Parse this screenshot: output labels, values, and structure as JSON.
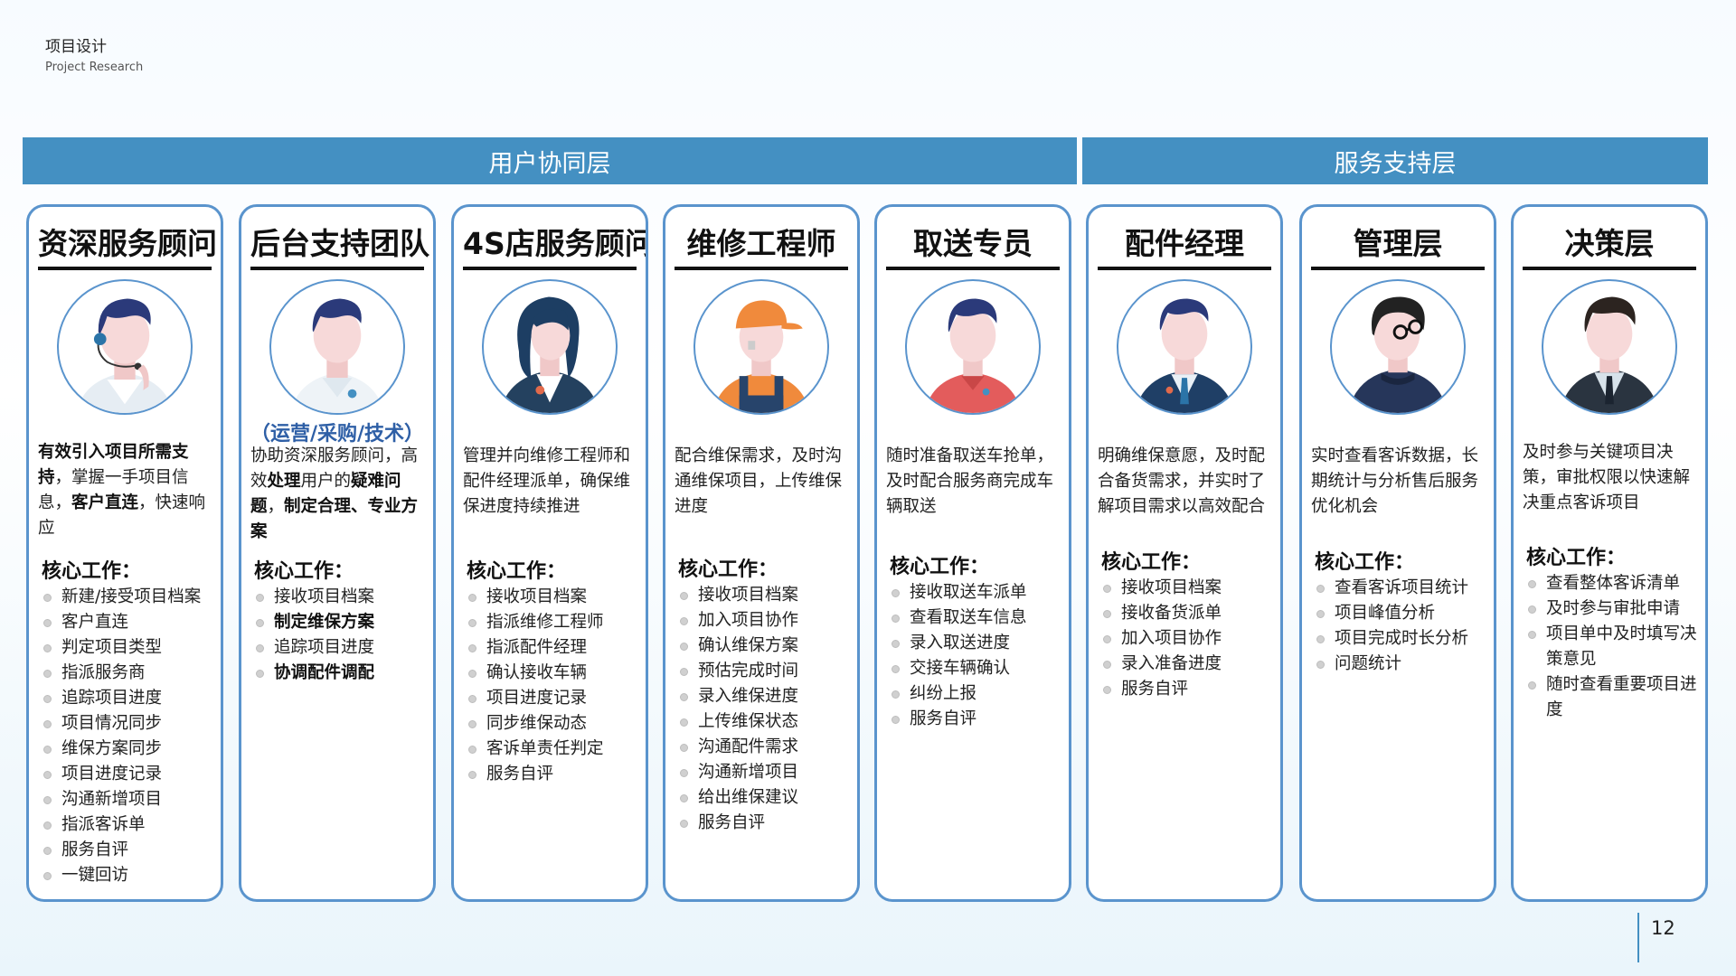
{
  "header": {
    "title": "项目设计",
    "subtitle": "Project Research"
  },
  "layers": {
    "user": "用户协同层",
    "service": "服务支持层"
  },
  "core_label": "核心工作：",
  "cards": [
    {
      "title": "资深服务顾问",
      "avatar": "headset-advisor-avatar",
      "desc_segments": [
        {
          "t": "有效引入项目所需支持",
          "b": true
        },
        {
          "t": "，掌握一手项目信息，",
          "b": false
        },
        {
          "t": "客户直连",
          "b": true
        },
        {
          "t": "，快速响应",
          "b": false
        }
      ],
      "items": [
        "新建/接受项目档案",
        "客户直连",
        "判定项目类型",
        "指派服务商",
        "追踪项目进度",
        "项目情况同步",
        "维保方案同步",
        "项目进度记录",
        "沟通新增项目",
        "指派客诉单",
        "服务自评",
        "一键回访"
      ],
      "bold_items": []
    },
    {
      "title": "后台支持团队",
      "avatar": "backoffice-avatar",
      "role_tag": "（运营/采购/技术）",
      "desc_segments": [
        {
          "t": "协助资深服务顾问，高效",
          "b": false
        },
        {
          "t": "处理",
          "b": true
        },
        {
          "t": "用户的",
          "b": false
        },
        {
          "t": "疑难问题",
          "b": true
        },
        {
          "t": "，",
          "b": false
        },
        {
          "t": "制定合理、专业方案",
          "b": true
        }
      ],
      "items": [
        "接收项目档案",
        "制定维保方案",
        "追踪项目进度",
        "协调配件调配"
      ],
      "bold_items": [
        1,
        3
      ]
    },
    {
      "title": "4S店服务顾问",
      "avatar": "female-advisor-avatar",
      "desc_segments": [
        {
          "t": "管理并向维修工程师和配件经理派单，确保维保进度持续推进",
          "b": false
        }
      ],
      "items": [
        "接收项目档案",
        "指派维修工程师",
        "指派配件经理",
        "确认接收车辆",
        "项目进度记录",
        "同步维保动态",
        "客诉单责任判定",
        "服务自评"
      ],
      "bold_items": []
    },
    {
      "title": "维修工程师",
      "avatar": "mechanic-avatar",
      "desc_segments": [
        {
          "t": "配合维保需求，及时沟通维保项目，上传维保进度",
          "b": false
        }
      ],
      "items": [
        "接收项目档案",
        "加入项目协作",
        "确认维保方案",
        "预估完成时间",
        "录入维保进度",
        "上传维保状态",
        "沟通配件需求",
        "沟通新增项目",
        "给出维保建议",
        "服务自评"
      ],
      "bold_items": []
    },
    {
      "title": "取送专员",
      "avatar": "driver-avatar",
      "desc_segments": [
        {
          "t": "随时准备取送车抢单，及时配合服务商完成车辆取送",
          "b": false
        }
      ],
      "items": [
        "接收取送车派单",
        "查看取送车信息",
        "录入取送进度",
        "交接车辆确认",
        "纠纷上报",
        "服务自评"
      ],
      "bold_items": []
    },
    {
      "title": "配件经理",
      "avatar": "parts-manager-avatar",
      "desc_segments": [
        {
          "t": "明确维保意愿，及时配合备货需求，并实时了解项目需求以高效配合",
          "b": false
        }
      ],
      "items": [
        "接收项目档案",
        "接收备货派单",
        "加入项目协作",
        "录入准备进度",
        "服务自评"
      ],
      "bold_items": []
    },
    {
      "title": "管理层",
      "avatar": "glasses-manager-avatar",
      "desc_segments": [
        {
          "t": "实时查看客诉数据，长期统计与分析售后服务优化机会",
          "b": false
        }
      ],
      "items": [
        "查看客诉项目统计",
        "项目峰值分析",
        "项目完成时长分析",
        "问题统计"
      ],
      "bold_items": []
    },
    {
      "title": "决策层",
      "avatar": "executive-avatar",
      "desc_segments": [
        {
          "t": "及时参与关键项目决策，审批权限以快速解决重点客诉项目",
          "b": false
        }
      ],
      "items": [
        "查看整体客诉清单",
        "及时参与审批申请",
        "项目单中及时填写决策意见",
        "随时查看重要项目进度"
      ],
      "bold_items": []
    }
  ],
  "colors": {
    "accent": "#4490c2",
    "card_border": "#5a94cd",
    "role_tag": "#2e5fa6"
  },
  "page_number": "12"
}
